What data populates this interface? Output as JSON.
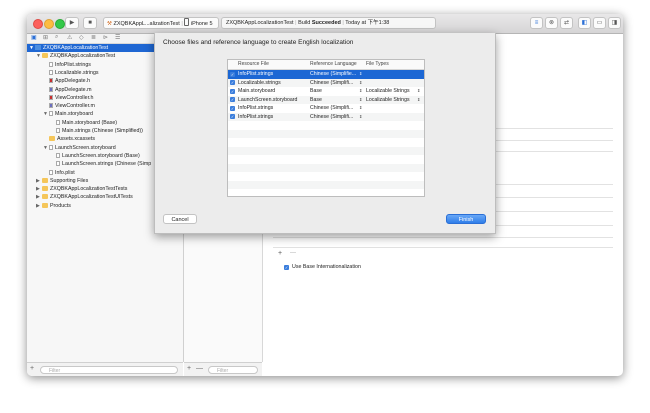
{
  "toolbar": {
    "scheme_project": "ZXQBKAppL...alizationTest",
    "scheme_device": "iPhone 5",
    "activity_project": "ZXQBKAppLocalizationTest",
    "activity_build": "Build",
    "activity_status": "Succeeded",
    "activity_time": "Today at 下午1:38"
  },
  "navigator": {
    "items": [
      {
        "label": "ZXQBKAppLocalizationTest",
        "icon": "project-icon",
        "indent": 0,
        "disclosure": "▼",
        "selected": true
      },
      {
        "label": "ZXQBKAppLocalizationTest",
        "icon": "folder-icon",
        "indent": 1,
        "disclosure": "▼"
      },
      {
        "label": "InfoPlist.strings",
        "icon": "file-icon",
        "indent": 2
      },
      {
        "label": "Localizable.strings",
        "icon": "file-icon",
        "indent": 2
      },
      {
        "label": "AppDelegate.h",
        "icon": "header-file-icon",
        "indent": 2
      },
      {
        "label": "AppDelegate.m",
        "icon": "source-file-icon",
        "indent": 2
      },
      {
        "label": "ViewController.h",
        "icon": "header-file-icon",
        "indent": 2
      },
      {
        "label": "ViewController.m",
        "icon": "source-file-icon",
        "indent": 2
      },
      {
        "label": "Main.storyboard",
        "icon": "storyboard-icon",
        "indent": 2,
        "disclosure": "▼"
      },
      {
        "label": "Main.storyboard (Base)",
        "icon": "file-icon",
        "indent": 3
      },
      {
        "label": "Main.strings (Chinese (Simplified))",
        "icon": "file-icon",
        "indent": 3
      },
      {
        "label": "Assets.xcassets",
        "icon": "folder-icon",
        "indent": 2
      },
      {
        "label": "LaunchScreen.storyboard",
        "icon": "storyboard-icon",
        "indent": 2,
        "disclosure": "▼"
      },
      {
        "label": "LaunchScreen.storyboard (Base)",
        "icon": "file-icon",
        "indent": 3
      },
      {
        "label": "LaunchScreen.strings (Chinese (Simp",
        "icon": "file-icon",
        "indent": 3
      },
      {
        "label": "Info.plist",
        "icon": "file-icon",
        "indent": 2
      },
      {
        "label": "Supporting Files",
        "icon": "folder-icon",
        "indent": 1,
        "disclosure": "▶"
      },
      {
        "label": "ZXQBKAppLocalizationTestTests",
        "icon": "folder-icon",
        "indent": 1,
        "disclosure": "▶"
      },
      {
        "label": "ZXQBKAppLocalizationTestUITests",
        "icon": "folder-icon",
        "indent": 1,
        "disclosure": "▶"
      },
      {
        "label": "Products",
        "icon": "folder-icon",
        "indent": 1,
        "disclosure": "▶"
      }
    ],
    "filter_placeholder": "Filter"
  },
  "middle": {
    "filter_placeholder": "Filter"
  },
  "sheet": {
    "title": "Choose files and reference language to create English localization",
    "columns": [
      "Resource File",
      "Reference Language",
      "File Types"
    ],
    "rows": [
      {
        "file": "InfoPlist.strings",
        "language": "Chinese (Simplifie...",
        "type": "",
        "selected": true
      },
      {
        "file": "Localizable.strings",
        "language": "Chinese (Simplifi...",
        "type": ""
      },
      {
        "file": "Main.storyboard",
        "language": "Base",
        "type": "Localizable Strings"
      },
      {
        "file": "LaunchScreen.storyboard",
        "language": "Base",
        "type": "Localizable Strings"
      },
      {
        "file": "InfoPlist.strings",
        "language": "Chinese (Simplifi...",
        "type": ""
      },
      {
        "file": "InfoPlist.strings",
        "language": "Chinese (Simplifi...",
        "type": ""
      }
    ],
    "cancel_label": "Cancel",
    "finish_label": "Finish"
  },
  "editor": {
    "add_label": "+",
    "remove_label": "—",
    "base_internationalization_label": "Use Base Internationalization"
  },
  "colors": {
    "accent": "#1f67d3",
    "finish": "#3b8af0"
  }
}
